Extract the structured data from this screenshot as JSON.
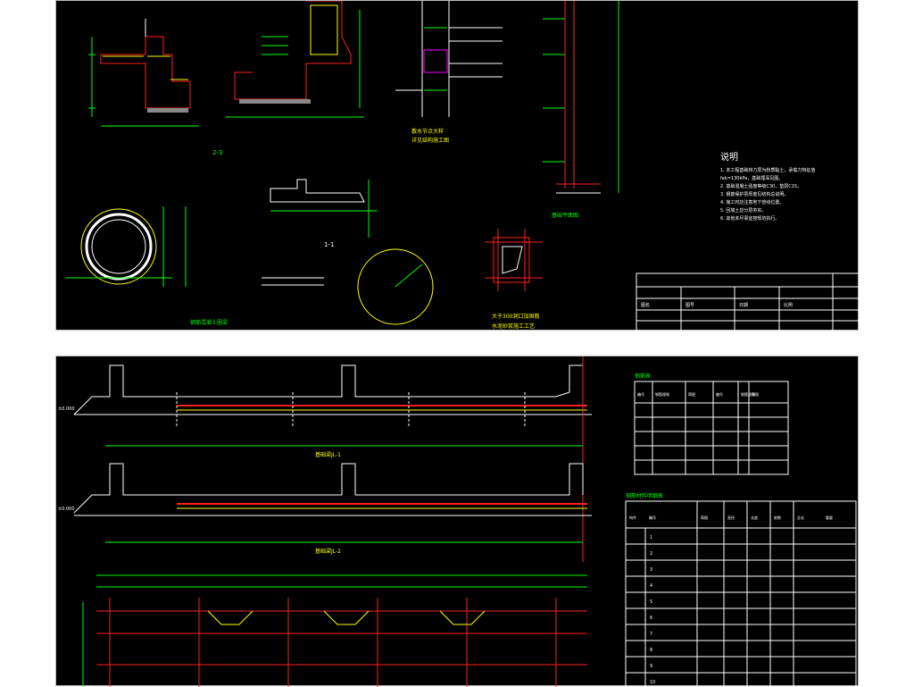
{
  "top_sheet": {
    "section_labels": {
      "sec_2_3": "2-3",
      "sec_1_1": "1-1",
      "caption_a": "散水节点大样",
      "caption_b": "详见结构施工图",
      "caption_c": "基础平面图",
      "caption_d": "钢筋混凝土圈梁",
      "caption_e": "大于300洞口加固筋",
      "caption_f": "水泥砂浆施工工艺"
    },
    "notes_title": "说明",
    "notes": [
      "1. 本工程基础持力层为粉质黏土，承载力特征值",
      "   fak=130kPa，基础埋深见图。",
      "2. 基础混凝土强度等级C30，垫层C15。",
      "3. 钢筋保护层厚度见结构总说明。",
      "4. 施工时应注意地下管线位置。",
      "5. 回填土应分层夯实。",
      "6. 其他未尽事宜按规范执行。"
    ],
    "title_block": {
      "col_labels": [
        "图名",
        "图号",
        "日期",
        "比例"
      ]
    }
  },
  "bottom_sheet": {
    "elevations": {
      "left_upper": "±0.000",
      "left_lower": "±0.000"
    },
    "beam_labels": [
      "基础梁JL-1",
      "基础梁JL-2"
    ],
    "rebar_table_title": "钢筋表",
    "rebar_table_headers": [
      "编号",
      "钢筋规格",
      "简图",
      "编号",
      "钢筋规格",
      "简图"
    ],
    "schedule_title": "钢筋材料明细表",
    "schedule_headers": [
      "构件",
      "编号",
      "简图",
      "直径",
      "长度",
      "根数",
      "总长",
      "重量"
    ],
    "schedule_rows": [
      "1",
      "2",
      "3",
      "4",
      "5",
      "6",
      "7",
      "8",
      "9",
      "10"
    ]
  },
  "colors": {
    "background": "#000000",
    "line_white": "#ffffff",
    "line_green": "#00ff00",
    "line_yellow": "#ffff00",
    "line_red": "#ff2020",
    "line_magenta": "#ff00ff",
    "line_cyan": "#00ffff"
  }
}
